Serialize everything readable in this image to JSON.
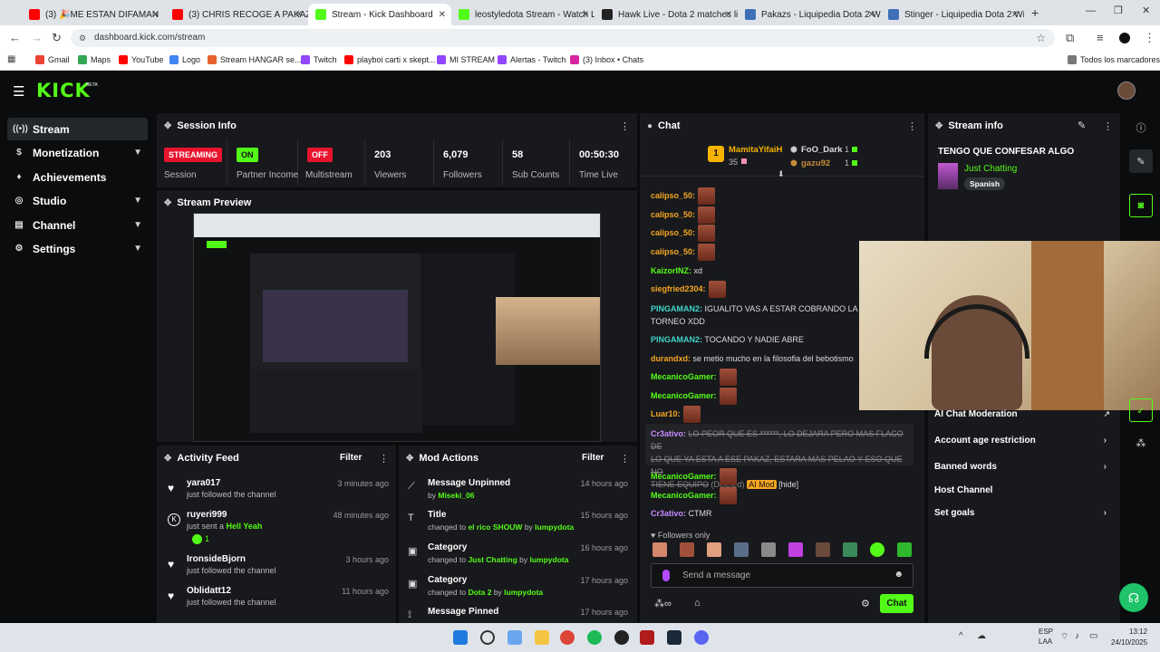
{
  "browser": {
    "tabs": [
      {
        "label": "(3) 🎉ME ESTAN DIFAMAN",
        "color": "#ff0000"
      },
      {
        "label": "(3) CHRIS RECOGE A PAKAZ",
        "color": "#ff0000"
      },
      {
        "label": "Stream - Kick Dashboard",
        "color": "#53fc18"
      },
      {
        "label": "leostyledota Stream - Watch L",
        "color": "#53fc18"
      },
      {
        "label": "Hawk Live - Dota 2 matches liv",
        "color": "#222222"
      },
      {
        "label": "Pakazs - Liquipedia Dota 2 Wiki",
        "color": "#3f6fb6"
      },
      {
        "label": "Stinger - Liquipedia Dota 2 Wiki",
        "color": "#3f6fb6"
      }
    ],
    "url": "dashboard.kick.com/stream",
    "bookmarks": [
      "Gmail",
      "Maps",
      "YouTube",
      "Logo",
      "Stream HANGAR se...",
      "Twitch",
      "playboi carti x skept...",
      "MI STREAM",
      "Alertas - Twitch",
      "(3) Inbox • Chats"
    ],
    "bookmarks_right": "Todos los marcadores"
  },
  "header": {
    "logo": "KICK",
    "beta": "BETA"
  },
  "sidebar": {
    "items": [
      {
        "label": "Stream",
        "icon": "stream-icon"
      },
      {
        "label": "Monetization",
        "icon": "dollar-icon"
      },
      {
        "label": "Achievements",
        "icon": "trophy-icon"
      },
      {
        "label": "Studio",
        "icon": "studio-icon"
      },
      {
        "label": "Channel",
        "icon": "channel-icon"
      },
      {
        "label": "Settings",
        "icon": "gear-icon"
      }
    ]
  },
  "session": {
    "title": "Session Info",
    "stats": [
      {
        "value": "STREAMING",
        "label": "Session",
        "badge": "#e8132e"
      },
      {
        "value": "ON",
        "label": "Partner Income",
        "badge": "#53fc18"
      },
      {
        "value": "OFF",
        "label": "Multistream",
        "badge": "#e8132e"
      },
      {
        "value": "203",
        "label": "Viewers"
      },
      {
        "value": "6,079",
        "label": "Followers"
      },
      {
        "value": "58",
        "label": "Sub Counts"
      },
      {
        "value": "00:50:30",
        "label": "Time Live"
      }
    ]
  },
  "preview": {
    "title": "Stream Preview"
  },
  "activity": {
    "title": "Activity Feed",
    "filter": "Filter",
    "items": [
      {
        "name": "yara017",
        "sub": "just followed the channel",
        "time": "3 minutes ago",
        "icon": "heart-icon"
      },
      {
        "name": "ruyeri999",
        "sub": "just sent a",
        "gift": "Hell Yeah",
        "extra": "1",
        "time": "48 minutes ago",
        "icon": "kick-icon"
      },
      {
        "name": "IronsideBjorn",
        "sub": "just followed the channel",
        "time": "3 hours ago",
        "icon": "heart-icon"
      },
      {
        "name": "Oblidatt12",
        "sub": "just followed the channel",
        "time": "11 hours ago",
        "icon": "heart-icon"
      }
    ]
  },
  "modactions": {
    "title": "Mod Actions",
    "filter": "Filter",
    "items": [
      {
        "title": "Message Unpinned",
        "pre": "by",
        "hl": "Miseki_06",
        "mid": "",
        "by": "",
        "time": "14 hours ago"
      },
      {
        "title": "Title",
        "pre": "changed to",
        "hl": "el rico SHOUW",
        "mid": "by",
        "by": "lumpydota",
        "time": "15 hours ago"
      },
      {
        "title": "Category",
        "pre": "changed to",
        "hl": "Just Chatting",
        "mid": "by",
        "by": "lumpydota",
        "time": "16 hours ago"
      },
      {
        "title": "Category",
        "pre": "changed to",
        "hl": "Dota 2",
        "mid": "by",
        "by": "lumpydota",
        "time": "17 hours ago"
      },
      {
        "title": "Message Pinned",
        "pre": "",
        "hl": "",
        "mid": "",
        "by": "",
        "time": "17 hours ago"
      }
    ]
  },
  "chat": {
    "title": "Chat",
    "top": {
      "rank": "1",
      "name": "MamitaYifaiH",
      "count": "35",
      "u2": "FoO_Dark",
      "c2": "1",
      "u3": "gazu92",
      "c3": "1"
    },
    "messages": [
      {
        "user": "calipso_50:",
        "text": "",
        "emote": true,
        "color": "#f5a623"
      },
      {
        "user": "calipso_50:",
        "text": "",
        "emote": true,
        "color": "#f5a623"
      },
      {
        "user": "calipso_50:",
        "text": "",
        "emote": true,
        "color": "#f5a623"
      },
      {
        "user": "calipso_50:",
        "text": "",
        "emote": true,
        "color": "#f5a623"
      },
      {
        "user": "KaizorINZ:",
        "text": "xd",
        "emote": false,
        "color": "#53fc18"
      },
      {
        "user": "siegfried2304:",
        "text": "",
        "emote": true,
        "color": "#f5a623"
      },
      {
        "user": "PINGAMAN2:",
        "text": "IGUALITO VAS A ESTAR COBRANDO LA P",
        "emote": false,
        "color": "#3fd3c9"
      },
      {
        "user": "",
        "text": "TORNEO XDD",
        "emote": false,
        "color": "#3fd3c9"
      },
      {
        "user": "PINGAMAN2:",
        "text": "TOCANDO Y NADIE ABRE",
        "emote": false,
        "color": "#3fd3c9"
      },
      {
        "user": "durandxd:",
        "text": "se metio mucho en la filosofia del bebotismo",
        "emote": false,
        "color": "#f5a623"
      },
      {
        "user": "MecanicoGamer:",
        "text": "",
        "emote": true,
        "color": "#53fc18"
      },
      {
        "user": "MecanicoGamer:",
        "text": "",
        "emote": true,
        "color": "#53fc18"
      },
      {
        "user": "Luar10:",
        "text": "",
        "emote": true,
        "color": "#f5a623"
      }
    ],
    "deleted": {
      "user": "Cr3ativo:",
      "l1": "LO PEOR QUE ES ******, LO DEJARA PERO MAS FLACO DE",
      "l2": "LO QUE YA ESTA A ESE PAKAZ, ESTARA MAS PELAO Y ESO QUE NO",
      "l3": "TIENE EQUIPO",
      "tag": "(Deleted)",
      "mod": "AI Mod",
      "hide": "[hide]"
    },
    "after": [
      {
        "user": "MecanicoGamer:",
        "text": "",
        "emote": true,
        "color": "#53fc18"
      },
      {
        "user": "MecanicoGamer:",
        "text": "",
        "emote": true,
        "color": "#53fc18"
      },
      {
        "user": "Cr3ativo:",
        "text": "CTMR",
        "emote": false,
        "color": "#c78bff"
      }
    ],
    "followers_only": "Followers only",
    "placeholder": "Send a message",
    "send": "Chat"
  },
  "streaminfo": {
    "title": "Stream info",
    "stream_title": "TENGO QUE CONFESAR ALGO",
    "category": "Just Chatting",
    "language": "Spanish",
    "menu": [
      "AI Chat Moderation",
      "Account age restriction",
      "Banned words",
      "Host Channel",
      "Set goals"
    ]
  },
  "taskbar": {
    "lang": "ESP",
    "layout": "LAA",
    "time": "13:12",
    "date": "24/10/2025"
  }
}
